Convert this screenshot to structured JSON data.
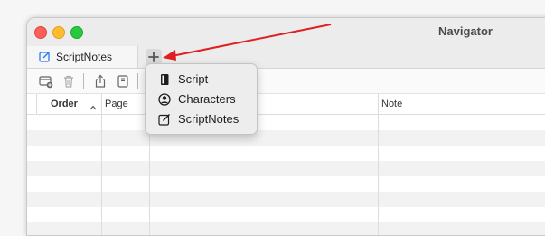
{
  "window": {
    "title": "Navigator"
  },
  "tabs": [
    {
      "label": "ScriptNotes",
      "icon": "note-edit-icon"
    }
  ],
  "add_tab_icon": "plus-icon",
  "toolbar": {
    "buttons": [
      "add-row-icon",
      "trash-icon",
      "share-icon",
      "book-icon"
    ]
  },
  "table": {
    "columns": [
      {
        "label": "Order",
        "sort": "ascending"
      },
      {
        "label": "Page"
      },
      {
        "label": ""
      },
      {
        "label": "Note"
      }
    ]
  },
  "menu": {
    "items": [
      {
        "label": "Script",
        "icon": "script-book-icon"
      },
      {
        "label": "Characters",
        "icon": "person-circle-icon"
      },
      {
        "label": "ScriptNotes",
        "icon": "note-edit-icon"
      }
    ]
  },
  "colors": {
    "accent": "#2a7cf0",
    "arrow": "#e02020"
  }
}
